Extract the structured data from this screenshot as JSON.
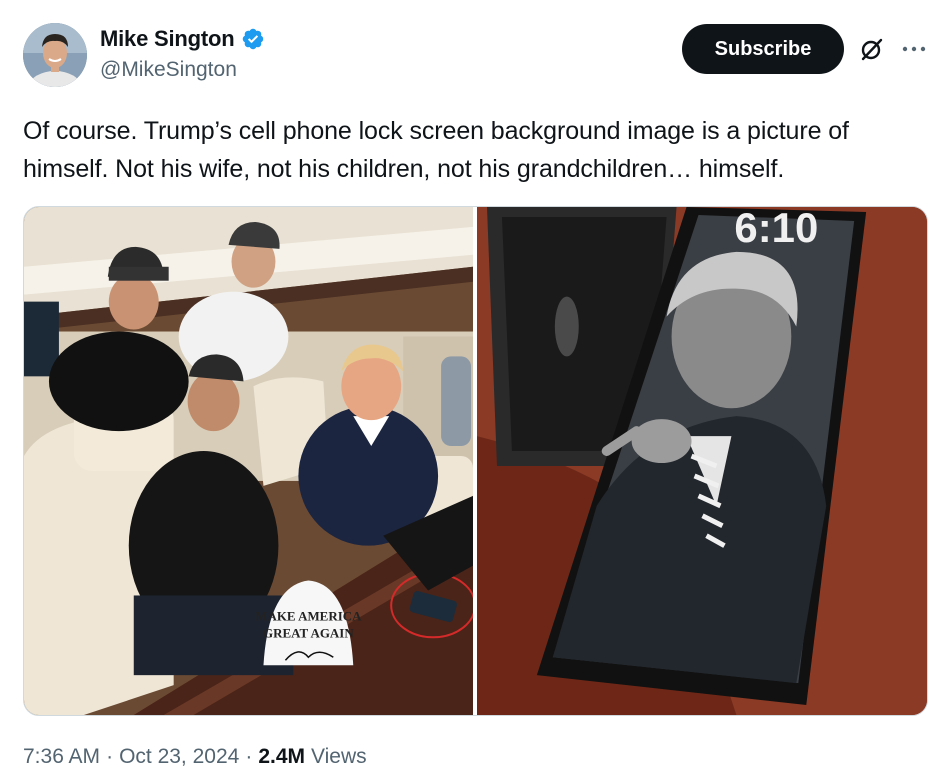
{
  "author": {
    "display_name": "Mike Sington",
    "handle": "@MikeSington",
    "verified": true,
    "avatar_icon": "avatar"
  },
  "actions": {
    "subscribe_label": "Subscribe",
    "grok_icon": "grok-icon",
    "more_icon": "more-icon"
  },
  "tweet": {
    "text": "Of course. Trump’s cell phone lock screen background image is a picture of himself. Not his wife, not his children, not his grandchildren… himself."
  },
  "media": {
    "left_image_text": {
      "hat_line1": "MAKE AMERICA",
      "hat_line2": "GREAT AGAIN"
    },
    "right_image_text": {
      "clock": "6:10"
    }
  },
  "meta": {
    "time": "7:36 AM",
    "separator": "·",
    "date": "Oct 23, 2024",
    "views_count": "2.4M",
    "views_label": "Views"
  },
  "colors": {
    "text_primary": "#0f1419",
    "text_secondary": "#536471",
    "verified_blue": "#1d9bf0",
    "button_bg": "#0f1419"
  }
}
